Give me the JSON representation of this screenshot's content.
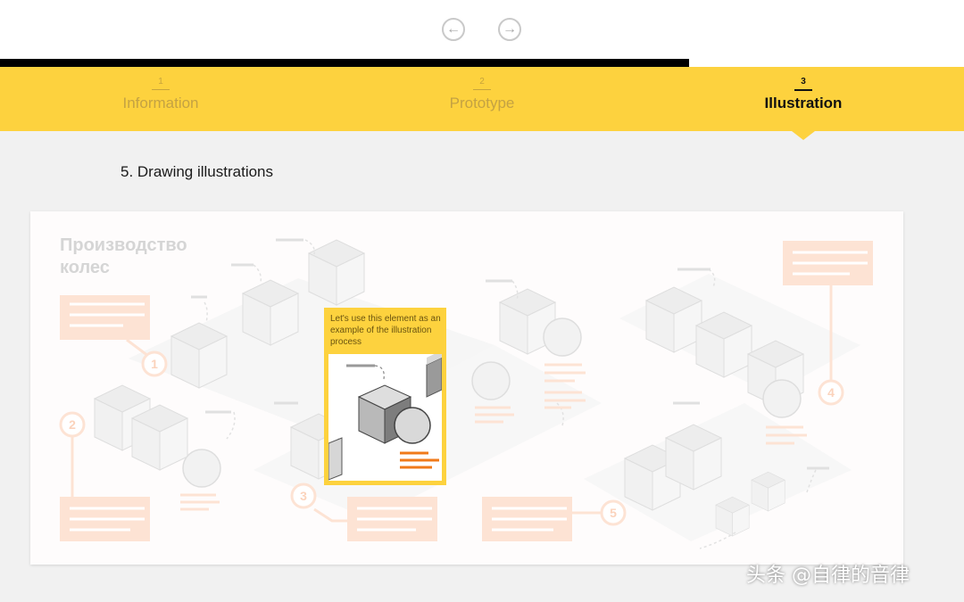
{
  "nav": {
    "prev_icon": "←",
    "next_icon": "→"
  },
  "steps": [
    {
      "num": "1",
      "label": "Information",
      "active": false
    },
    {
      "num": "2",
      "label": "Prototype",
      "active": false
    },
    {
      "num": "3",
      "label": "Illustration",
      "active": true
    }
  ],
  "section": {
    "title": "5. Drawing illustrations"
  },
  "illustration": {
    "title_line1": "Производство",
    "title_line2": "колес",
    "markers": [
      "1",
      "2",
      "3",
      "4",
      "5"
    ],
    "callout_text": "Let's use this element as an example of the illustration process"
  },
  "watermark": "头条 @自律的音律",
  "colors": {
    "accent": "#fdd23e",
    "progress": "#000000",
    "orange": "#f07a1a",
    "peach": "#fde3d4"
  }
}
